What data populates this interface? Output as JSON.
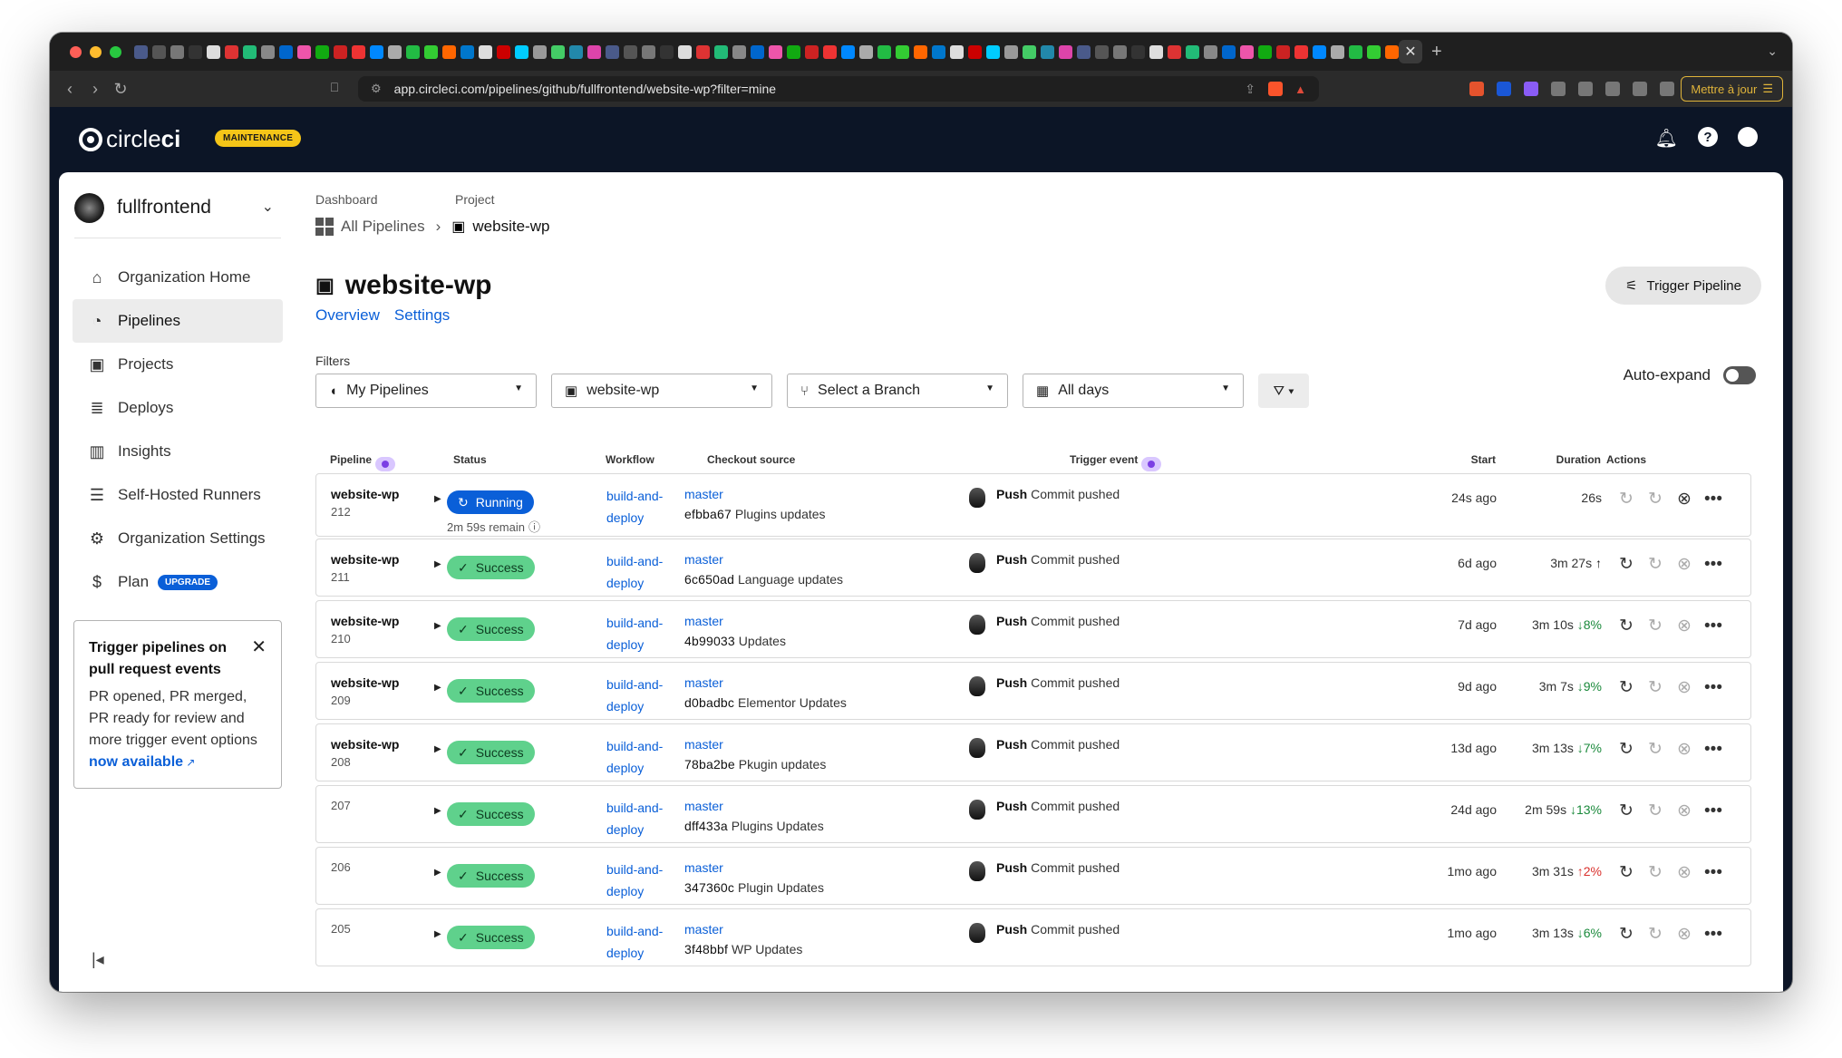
{
  "browser": {
    "url": "app.circleci.com/pipelines/github/fullfrontend/website-wp?filter=mine",
    "update_label": "Mettre à jour"
  },
  "header": {
    "logo_text_light": "circle",
    "logo_text_bold": "ci",
    "badge": "MAINTENANCE"
  },
  "sidebar": {
    "org_name": "fullfrontend",
    "items": [
      {
        "label": "Organization Home",
        "icon": "home-icon"
      },
      {
        "label": "Pipelines",
        "icon": "pipelines-icon",
        "active": true
      },
      {
        "label": "Projects",
        "icon": "projects-icon"
      },
      {
        "label": "Deploys",
        "icon": "deploys-icon"
      },
      {
        "label": "Insights",
        "icon": "insights-icon"
      },
      {
        "label": "Self-Hosted Runners",
        "icon": "runners-icon"
      },
      {
        "label": "Organization Settings",
        "icon": "gear-icon"
      },
      {
        "label": "Plan",
        "icon": "dollar-icon",
        "badge": "UPGRADE"
      }
    ],
    "promo": {
      "title": "Trigger pipelines on pull request events",
      "body": "PR opened, PR merged, PR ready for review and more trigger event options",
      "link": "now available"
    }
  },
  "breadcrumb": {
    "label1": "Dashboard",
    "label2": "Project",
    "item1": "All Pipelines",
    "item2": "website-wp"
  },
  "project": {
    "title": "website-wp",
    "tabs": [
      "Overview",
      "Settings"
    ],
    "trigger_label": "Trigger Pipeline"
  },
  "filters": {
    "label": "Filters",
    "pipelines": "My Pipelines",
    "project": "website-wp",
    "branch": "Select a Branch",
    "days": "All days",
    "auto_expand": "Auto-expand"
  },
  "table": {
    "headers": [
      "Pipeline",
      "Status",
      "Workflow",
      "Checkout source",
      "Trigger event",
      "Start",
      "Duration",
      "Actions"
    ],
    "rows": [
      {
        "name": "website-wp",
        "num": "212",
        "status": "Running",
        "remain": "2m 59s remain",
        "wf1": "build-and-",
        "wf2": "deploy",
        "branch": "master",
        "sha": "efbba67",
        "msg": "Plugins updates",
        "trig_bold": "Push",
        "trig": "Commit pushed",
        "start": "24s ago",
        "dur": "26s",
        "delta": ""
      },
      {
        "name": "website-wp",
        "num": "211",
        "status": "Success",
        "wf1": "build-and-",
        "wf2": "deploy",
        "branch": "master",
        "sha": "6c650ad",
        "msg": "Language updates",
        "trig_bold": "Push",
        "trig": "Commit pushed",
        "start": "6d ago",
        "dur": "3m 27s",
        "delta": "↑",
        "delta_type": "up"
      },
      {
        "name": "website-wp",
        "num": "210",
        "status": "Success",
        "wf1": "build-and-",
        "wf2": "deploy",
        "branch": "master",
        "sha": "4b99033",
        "msg": "Updates",
        "trig_bold": "Push",
        "trig": "Commit pushed",
        "start": "7d ago",
        "dur": "3m 10s",
        "delta": "↓8%",
        "delta_type": "d"
      },
      {
        "name": "website-wp",
        "num": "209",
        "status": "Success",
        "wf1": "build-and-",
        "wf2": "deploy",
        "branch": "master",
        "sha": "d0badbc",
        "msg": "Elementor Updates",
        "trig_bold": "Push",
        "trig": "Commit pushed",
        "start": "9d ago",
        "dur": "3m 7s",
        "delta": "↓9%",
        "delta_type": "d"
      },
      {
        "name": "website-wp",
        "num": "208",
        "status": "Success",
        "wf1": "build-and-",
        "wf2": "deploy",
        "branch": "master",
        "sha": "78ba2be",
        "msg": "Pkugin updates",
        "trig_bold": "Push",
        "trig": "Commit pushed",
        "start": "13d ago",
        "dur": "3m 13s",
        "delta": "↓7%",
        "delta_type": "d"
      },
      {
        "name": "",
        "num": "207",
        "status": "Success",
        "wf1": "build-and-",
        "wf2": "deploy",
        "branch": "master",
        "sha": "dff433a",
        "msg": "Plugins Updates",
        "trig_bold": "Push",
        "trig": "Commit pushed",
        "start": "24d ago",
        "dur": "2m 59s",
        "delta": "↓13%",
        "delta_type": "d"
      },
      {
        "name": "",
        "num": "206",
        "status": "Success",
        "wf1": "build-and-",
        "wf2": "deploy",
        "branch": "master",
        "sha": "347360c",
        "msg": "Plugin Updates",
        "trig_bold": "Push",
        "trig": "Commit pushed",
        "start": "1mo ago",
        "dur": "3m 31s",
        "delta": "↑2%",
        "delta_type": "u"
      },
      {
        "name": "",
        "num": "205",
        "status": "Success",
        "wf1": "build-and-",
        "wf2": "deploy",
        "branch": "master",
        "sha": "3f48bbf",
        "msg": "WP Updates",
        "trig_bold": "Push",
        "trig": "Commit pushed",
        "start": "1mo ago",
        "dur": "3m 13s",
        "delta": "↓6%",
        "delta_type": "d"
      }
    ]
  },
  "colors": {
    "header_bg": "#0c1526",
    "link": "#0a5fd8",
    "success": "#5fd18c",
    "running": "#0a5fd8",
    "maintenance": "#f5c518"
  }
}
